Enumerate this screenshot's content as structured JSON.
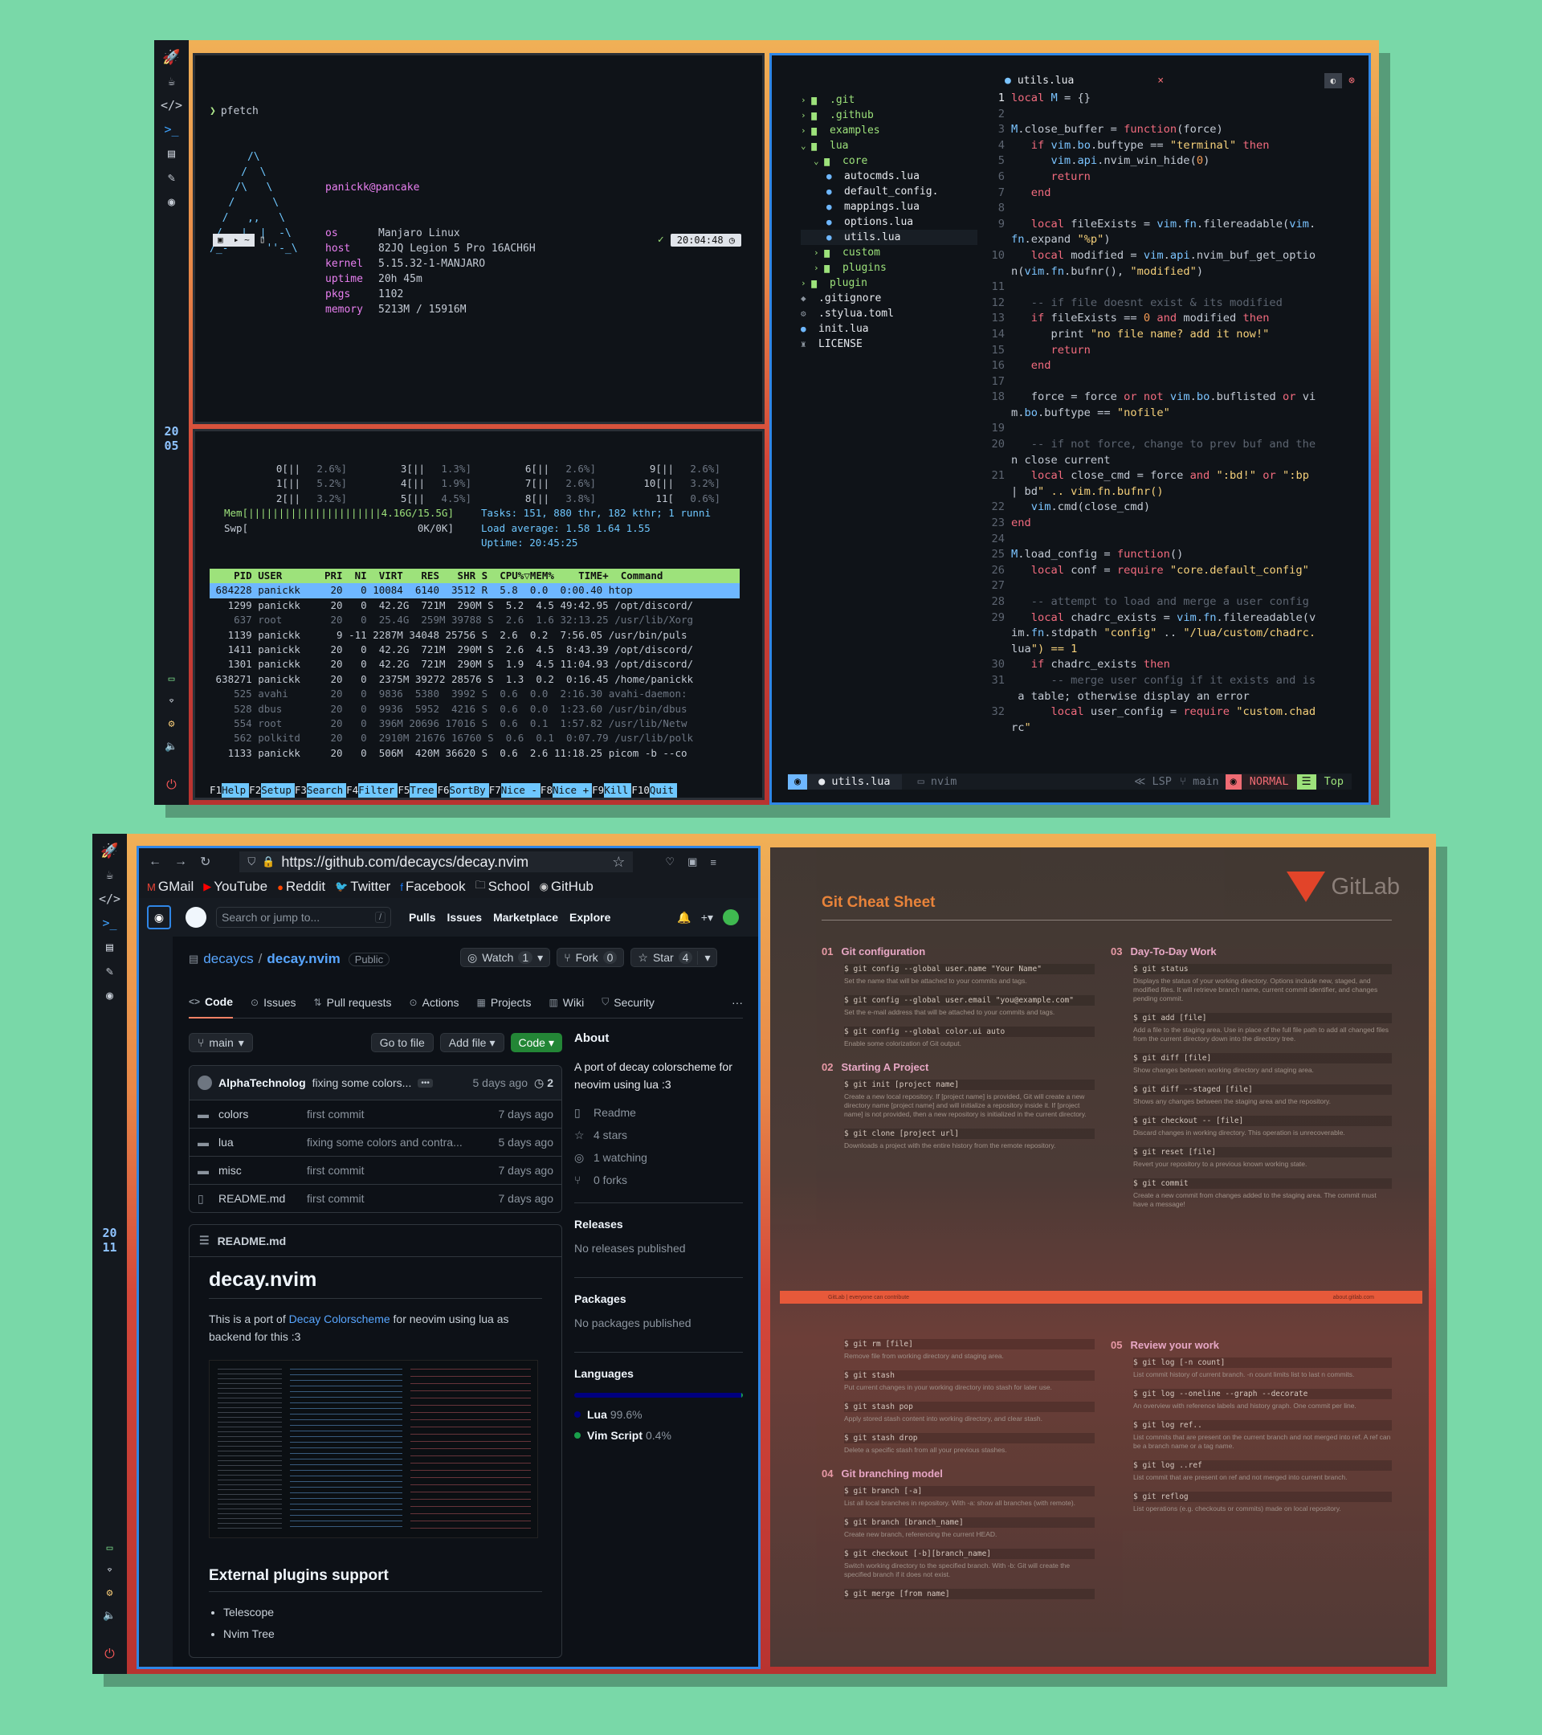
{
  "top": {
    "sidebar_clock": [
      "20",
      "05"
    ],
    "pfetch": {
      "cmd": "pfetch",
      "user": "panickk@pancake",
      "rows": [
        [
          "os",
          "Manjaro Linux"
        ],
        [
          "host",
          "82JQ Legion 5 Pro 16ACH6H"
        ],
        [
          "kernel",
          "5.15.32-1-MANJARO"
        ],
        [
          "uptime",
          "20h 45m"
        ],
        [
          "pkgs",
          "1102"
        ],
        [
          "memory",
          "5213M / 15916M"
        ]
      ],
      "logo": [
        "      /\\",
        "     /  \\",
        "    /\\   \\",
        "   /      \\",
        "  /   ,,   \\",
        " /   |  |  -\\",
        "/_-''    ''-_\\"
      ],
      "time": "20:04:48",
      "check": "✓"
    },
    "htop": {
      "cpus": [
        [
          "0[||",
          "2.6%]",
          "3[||",
          "1.3%]",
          "6[||",
          "2.6%]",
          "9[||",
          "2.6%]"
        ],
        [
          "1[||",
          "5.2%]",
          "4[||",
          "1.9%]",
          "7[||",
          "2.6%]",
          "10[||",
          "3.2%]"
        ],
        [
          "2[||",
          "3.2%]",
          "5[||",
          "4.5%]",
          "8[||",
          "3.8%]",
          "11[",
          "0.6%]"
        ]
      ],
      "mem": "Mem[||||||||||||||||||||||4.16G/15.5G]",
      "swp": "Swp[                            0K/0K]",
      "tasks": "Tasks: 151, 880 thr, 182 kthr; 1 runni",
      "load": "Load average: 1.58 1.64 1.55",
      "uptime": "Uptime: 20:45:25",
      "header": "    PID USER       PRI  NI  VIRT   RES   SHR S  CPU%▽MEM%    TIME+  Command",
      "rows": [
        " 684228 panickk     20   0 10084  6140  3512 R  5.8  0.0  0:00.40 htop",
        "   1299 panickk     20   0  42.2G  721M  290M S  5.2  4.5 49:42.95 /opt/discord/",
        "    637 root        20   0  25.4G  259M 39788 S  2.6  1.6 32:13.25 /usr/lib/Xorg",
        "   1139 panickk      9 -11 2287M 34048 25756 S  2.6  0.2  7:56.05 /usr/bin/puls",
        "   1411 panickk     20   0  42.2G  721M  290M S  2.6  4.5  8:43.39 /opt/discord/",
        "   1301 panickk     20   0  42.2G  721M  290M S  1.9  4.5 11:04.93 /opt/discord/",
        " 638271 panickk     20   0  2375M 39272 28576 S  1.3  0.2  0:16.45 /home/panickk",
        "    525 avahi       20   0  9836  5380  3992 S  0.6  0.0  2:16.30 avahi-daemon:",
        "    528 dbus        20   0  9936  5952  4216 S  0.6  0.0  1:23.60 /usr/bin/dbus",
        "    554 root        20   0  396M 20696 17016 S  0.6  0.1  1:57.82 /usr/lib/Netw",
        "    562 polkitd     20   0  2910M 21676 16760 S  0.6  0.1  0:07.79 /usr/lib/polk",
        "   1133 panickk     20   0  506M  420M 36620 S  0.6  2.6 11:18.25 picom -b --co"
      ],
      "fkeys": [
        [
          "F1",
          "Help"
        ],
        [
          "F2",
          "Setup"
        ],
        [
          "F3",
          "Search"
        ],
        [
          "F4",
          "Filter"
        ],
        [
          "F5",
          "Tree"
        ],
        [
          "F6",
          "SortBy"
        ],
        [
          "F7",
          "Nice -"
        ],
        [
          "F8",
          "Nice +"
        ],
        [
          "F9",
          "Kill"
        ],
        [
          "F10",
          "Quit"
        ]
      ]
    },
    "nvim": {
      "tree": [
        [
          0,
          "›",
          ".git",
          "dir"
        ],
        [
          0,
          "›",
          ".github",
          "dir"
        ],
        [
          0,
          "›",
          "examples",
          "dir"
        ],
        [
          0,
          "⌄",
          "lua",
          "dir"
        ],
        [
          1,
          "⌄",
          "core",
          "dir"
        ],
        [
          2,
          "●",
          "autocmds.lua",
          "lua"
        ],
        [
          2,
          "●",
          "default_config.",
          "lua"
        ],
        [
          2,
          "●",
          "mappings.lua",
          "lua"
        ],
        [
          2,
          "●",
          "options.lua",
          "lua"
        ],
        [
          2,
          "●",
          "utils.lua",
          "lua"
        ],
        [
          1,
          "›",
          "custom",
          "dir"
        ],
        [
          1,
          "›",
          "plugins",
          "dir"
        ],
        [
          0,
          "›",
          "plugin",
          "dir"
        ],
        [
          0,
          "◆",
          ".gitignore",
          "file"
        ],
        [
          0,
          "⚙",
          ".stylua.toml",
          "file"
        ],
        [
          0,
          "●",
          "init.lua",
          "lua"
        ],
        [
          0,
          "♜",
          "LICENSE",
          "file"
        ]
      ],
      "tab": "utils.lua",
      "tab_close": "×",
      "lines": [
        [
          "1",
          "local M = {}"
        ],
        [
          "2",
          ""
        ],
        [
          "3",
          "M.close_buffer = function(force)"
        ],
        [
          "4",
          "   if vim.bo.buftype == \"terminal\" then"
        ],
        [
          "5",
          "      vim.api.nvim_win_hide(0)"
        ],
        [
          "6",
          "      return"
        ],
        [
          "7",
          "   end"
        ],
        [
          "8",
          ""
        ],
        [
          "9",
          "   local fileExists = vim.fn.filereadable(vim."
        ],
        [
          "",
          "fn.expand \"%p\")"
        ],
        [
          "10",
          "   local modified = vim.api.nvim_buf_get_optio"
        ],
        [
          "",
          "n(vim.fn.bufnr(), \"modified\")"
        ],
        [
          "11",
          ""
        ],
        [
          "12",
          "   -- if file doesnt exist & its modified"
        ],
        [
          "13",
          "   if fileExists == 0 and modified then"
        ],
        [
          "14",
          "      print \"no file name? add it now!\""
        ],
        [
          "15",
          "      return"
        ],
        [
          "16",
          "   end"
        ],
        [
          "17",
          ""
        ],
        [
          "18",
          "   force = force or not vim.bo.buflisted or vi"
        ],
        [
          "",
          "m.bo.buftype == \"nofile\""
        ],
        [
          "19",
          ""
        ],
        [
          "20",
          "   -- if not force, change to prev buf and the"
        ],
        [
          "",
          "n close current"
        ],
        [
          "21",
          "   local close_cmd = force and \":bd!\" or \":bp"
        ],
        [
          "",
          "| bd\" .. vim.fn.bufnr()"
        ],
        [
          "22",
          "   vim.cmd(close_cmd)"
        ],
        [
          "23",
          "end"
        ],
        [
          "24",
          ""
        ],
        [
          "25",
          "M.load_config = function()"
        ],
        [
          "26",
          "   local conf = require \"core.default_config\""
        ],
        [
          "27",
          ""
        ],
        [
          "28",
          "   -- attempt to load and merge a user config"
        ],
        [
          "29",
          "   local chadrc_exists = vim.fn.filereadable(v"
        ],
        [
          "",
          "im.fn.stdpath \"config\" .. \"/lua/custom/chadrc."
        ],
        [
          "",
          "lua\") == 1"
        ],
        [
          "30",
          "   if chadrc_exists then"
        ],
        [
          "31",
          "      -- merge user config if it exists and is"
        ],
        [
          "",
          " a table; otherwise display an error"
        ],
        [
          "32",
          "      local user_config = require \"custom.chad"
        ],
        [
          "",
          "rc\""
        ]
      ],
      "status": {
        "file": "utils.lua",
        "app": "nvim",
        "lsp": "LSP",
        "branch": "main",
        "mode": "NORMAL",
        "pos": "Top"
      }
    }
  },
  "bottom": {
    "sidebar_clock": [
      "20",
      "11"
    ],
    "browser": {
      "url": "https://github.com/decaycs/decay.nvim",
      "bookmarks": [
        "GMail",
        "YouTube",
        "Reddit",
        "Twitter",
        "Facebook",
        "School",
        "GitHub"
      ]
    },
    "github": {
      "search_placeholder": "Search or jump to...",
      "search_key": "/",
      "nav": [
        "Pulls",
        "Issues",
        "Marketplace",
        "Explore"
      ],
      "owner": "decaycs",
      "repo": "decay.nvim",
      "visibility": "Public",
      "watch": "Watch",
      "watch_n": "1",
      "fork": "Fork",
      "fork_n": "0",
      "star": "Star",
      "star_n": "4",
      "tabs": [
        "Code",
        "Issues",
        "Pull requests",
        "Actions",
        "Projects",
        "Wiki",
        "Security"
      ],
      "branch": "main",
      "goto": "Go to file",
      "addfile": "Add file",
      "code_btn": "Code",
      "commit": {
        "author": "AlphaTechnolog",
        "msg": "fixing some colors...",
        "ago": "5 days ago",
        "count": "2"
      },
      "files": [
        [
          "colors",
          "first commit",
          "7 days ago",
          "dir"
        ],
        [
          "lua",
          "fixing some colors and contra...",
          "5 days ago",
          "dir"
        ],
        [
          "misc",
          "first commit",
          "7 days ago",
          "dir"
        ],
        [
          "README.md",
          "first commit",
          "7 days ago",
          "file"
        ]
      ],
      "readme_label": "README.md",
      "readme_title": "decay.nvim",
      "readme_p1": "This is a port of ",
      "readme_link": "Decay Colorscheme",
      "readme_p2": " for neovim using lua as backend for this :3",
      "plugins_title": "External plugins support",
      "plugins": [
        "Telescope",
        "Nvim Tree"
      ],
      "about_title": "About",
      "about": "A port of decay colorscheme for neovim using lua :3",
      "about_items": [
        "Readme",
        "4 stars",
        "1 watching",
        "0 forks"
      ],
      "releases_title": "Releases",
      "releases": "No releases published",
      "packages_title": "Packages",
      "packages": "No packages published",
      "languages_title": "Languages",
      "languages": [
        [
          "Lua",
          "99.6%",
          "#000080"
        ],
        [
          "Vim Script",
          "0.4%",
          "#199f4b"
        ]
      ]
    },
    "cheat": {
      "title": "Git Cheat Sheet",
      "brand": "GitLab",
      "sections": [
        {
          "num": "01",
          "title": "Git configuration",
          "items": [
            [
              "$ git config --global user.name \"Your Name\"",
              "Set the name that will be attached to your commits and tags."
            ],
            [
              "$ git config --global user.email \"you@example.com\"",
              "Set the e-mail address that will be attached to your commits and tags."
            ],
            [
              "$ git config --global color.ui auto",
              "Enable some colorization of Git output."
            ]
          ]
        },
        {
          "num": "02",
          "title": "Starting A Project",
          "items": [
            [
              "$ git init [project name]",
              "Create a new local repository. If [project name] is provided, Git will create a new directory name [project name] and will initialize a repository inside it. If [project name] is not provided, then a new repository is initialized in the current directory."
            ],
            [
              "$ git clone [project url]",
              "Downloads a project with the entire history from the remote repository."
            ]
          ]
        },
        {
          "num": "03",
          "title": "Day-To-Day Work",
          "items": [
            [
              "$ git status",
              "Displays the status of your working directory. Options include new, staged, and modified files. It will retrieve branch name, current commit identifier, and changes pending commit."
            ],
            [
              "$ git add [file]",
              "Add a file to the staging area. Use in place of the full file path to add all changed files from the current directory down into the directory tree."
            ],
            [
              "$ git diff [file]",
              "Show changes between working directory and staging area."
            ],
            [
              "$ git diff --staged [file]",
              "Shows any changes between the staging area and the repository."
            ],
            [
              "$ git checkout -- [file]",
              "Discard changes in working directory. This operation is unrecoverable."
            ],
            [
              "$ git reset [file]",
              "Revert your repository to a previous known working state."
            ],
            [
              "$ git commit",
              "Create a new commit from changes added to the staging area. The commit must have a message!"
            ]
          ]
        },
        {
          "num": "",
          "title": "",
          "items": [
            [
              "$ git rm [file]",
              "Remove file from working directory and staging area."
            ],
            [
              "$ git stash",
              "Put current changes in your working directory into stash for later use."
            ],
            [
              "$ git stash pop",
              "Apply stored stash content into working directory, and clear stash."
            ],
            [
              "$ git stash drop",
              "Delete a specific stash from all your previous stashes."
            ]
          ]
        },
        {
          "num": "04",
          "title": "Git branching model",
          "items": [
            [
              "$ git branch [-a]",
              "List all local branches in repository. With -a: show all branches (with remote)."
            ],
            [
              "$ git branch [branch_name]",
              "Create new branch, referencing the current HEAD."
            ],
            [
              "$ git checkout [-b][branch_name]",
              "Switch working directory to the specified branch. With -b: Git will create the specified branch if it does not exist."
            ],
            [
              "$ git merge [from name]",
              ""
            ]
          ]
        },
        {
          "num": "05",
          "title": "Review your work",
          "items": [
            [
              "$ git log [-n count]",
              "List commit history of current branch. -n count limits list to last n commits."
            ],
            [
              "$ git log --oneline --graph --decorate",
              "An overview with reference labels and history graph. One commit per line."
            ],
            [
              "$ git log ref..",
              "List commits that are present on the current branch and not merged into ref. A ref can be a branch name or a tag name."
            ],
            [
              "$ git log ..ref",
              "List commit that are present on ref and not merged into current branch."
            ],
            [
              "$ git reflog",
              "List operations (e.g. checkouts or commits) made on local repository."
            ]
          ]
        }
      ],
      "band_left": "GitLab | everyone can contribute",
      "band_right": "about.gitlab.com"
    }
  }
}
